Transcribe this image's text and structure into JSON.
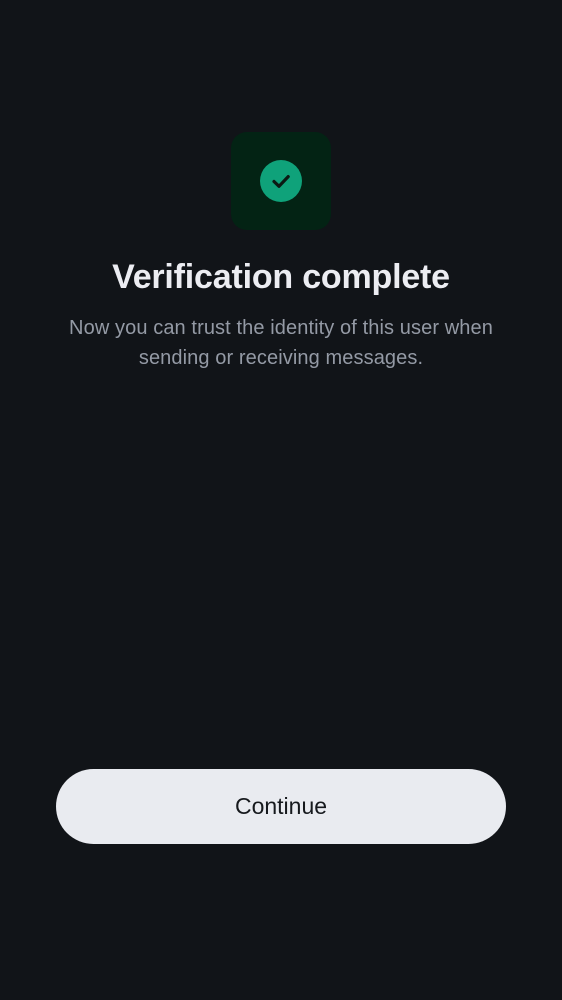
{
  "verification": {
    "icon": "check-circle-icon",
    "title": "Verification complete",
    "description": "Now you can trust the identity of this user when sending or receiving messages."
  },
  "actions": {
    "continue_label": "Continue"
  },
  "colors": {
    "background": "#111418",
    "icon_tile": "#032314",
    "success_green": "#0fa27a",
    "button_background": "#e9ebf0"
  }
}
